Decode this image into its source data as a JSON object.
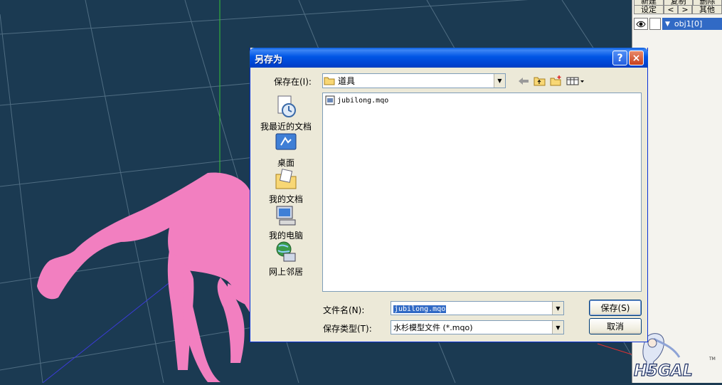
{
  "right_panel": {
    "tabs_row1": [
      "新建",
      "复制",
      "删除"
    ],
    "tabs_row2": [
      "设定",
      "<",
      ">",
      "其他"
    ],
    "object_name": "obj1[0]"
  },
  "dialog": {
    "title": "另存为",
    "help_label": "?",
    "close_label": "×",
    "save_in_label": "保存在(I):",
    "save_in_value": "道具",
    "places": [
      {
        "label": "我最近的文档",
        "icon": "recent-documents-icon"
      },
      {
        "label": "桌面",
        "icon": "desktop-icon"
      },
      {
        "label": "我的文档",
        "icon": "my-documents-icon"
      },
      {
        "label": "我的电脑",
        "icon": "my-computer-icon"
      },
      {
        "label": "网上邻居",
        "icon": "network-places-icon"
      }
    ],
    "files": [
      {
        "name": "jubilong.mqo",
        "icon": "mqo-file-icon"
      }
    ],
    "filename_label": "文件名(N):",
    "filename_value": "jubilong.mqo",
    "filetype_label": "保存类型(T):",
    "filetype_value": "水杉模型文件 (*.mqo)",
    "save_button": "保存(S)",
    "cancel_button": "取消"
  },
  "colors": {
    "viewport_bg": "#1b3a52",
    "model": "#f27fc0",
    "titlebar": "#0055e5",
    "selection": "#316ac5"
  }
}
